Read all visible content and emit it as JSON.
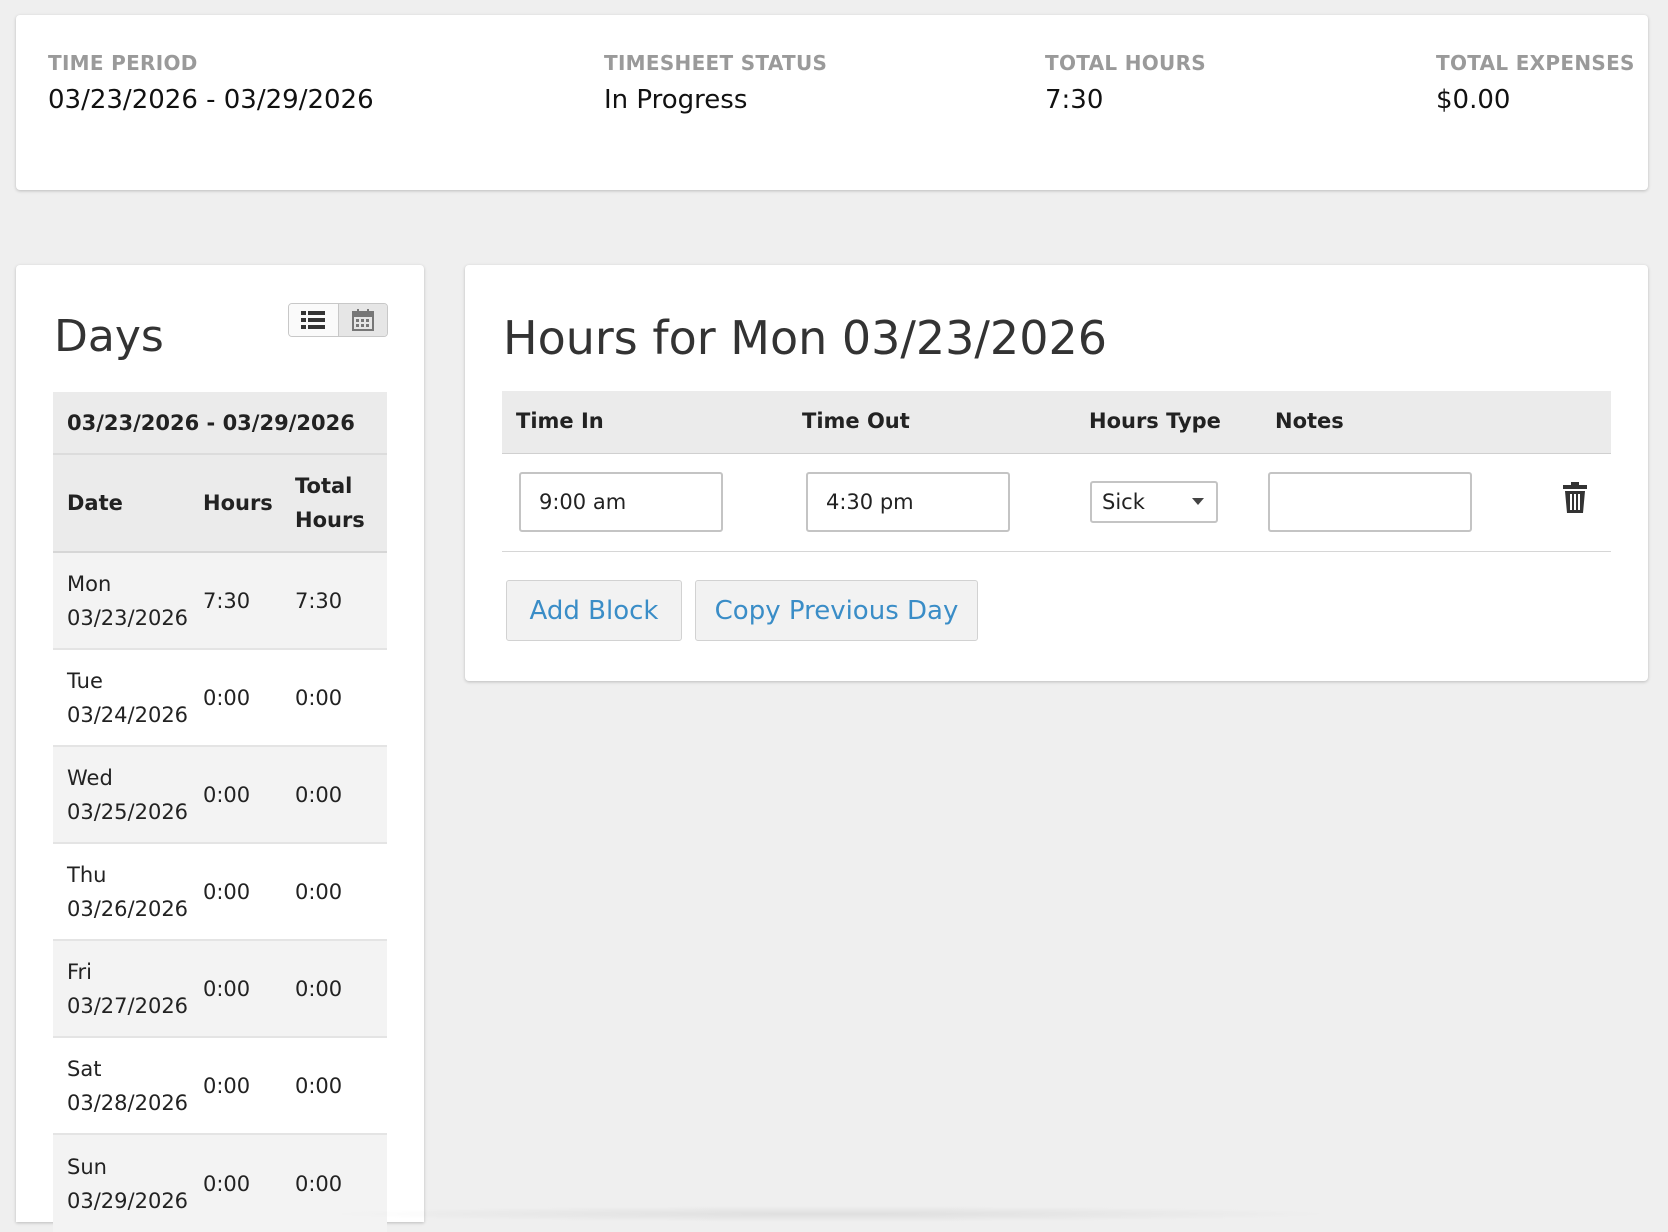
{
  "summary": {
    "time_period": {
      "label": "TIME PERIOD",
      "value": "03/23/2026 - 03/29/2026"
    },
    "status": {
      "label": "TIMESHEET STATUS",
      "value": "In Progress"
    },
    "total_hours": {
      "label": "TOTAL HOURS",
      "value": "7:30"
    },
    "total_expenses": {
      "label": "TOTAL EXPENSES",
      "value": "$0.00"
    }
  },
  "days": {
    "title": "Days",
    "range": "03/23/2026 - 03/29/2026",
    "headers": {
      "date": "Date",
      "hours": "Hours",
      "total_line1": "Total",
      "total_line2": "Hours"
    },
    "rows": [
      {
        "day": "Mon",
        "date": "03/23/2026",
        "hours": "7:30",
        "total": "7:30"
      },
      {
        "day": "Tue",
        "date": "03/24/2026",
        "hours": "0:00",
        "total": "0:00"
      },
      {
        "day": "Wed",
        "date": "03/25/2026",
        "hours": "0:00",
        "total": "0:00"
      },
      {
        "day": "Thu",
        "date": "03/26/2026",
        "hours": "0:00",
        "total": "0:00"
      },
      {
        "day": "Fri",
        "date": "03/27/2026",
        "hours": "0:00",
        "total": "0:00"
      },
      {
        "day": "Sat",
        "date": "03/28/2026",
        "hours": "0:00",
        "total": "0:00"
      },
      {
        "day": "Sun",
        "date": "03/29/2026",
        "hours": "0:00",
        "total": "0:00"
      }
    ],
    "view_icons": {
      "list": "list-icon",
      "calendar": "calendar-icon"
    }
  },
  "hours": {
    "title": "Hours for Mon 03/23/2026",
    "headers": {
      "time_in": "Time In",
      "time_out": "Time Out",
      "hours_type": "Hours Type",
      "notes": "Notes"
    },
    "block": {
      "time_in": "9:00 am",
      "time_out": "4:30 pm",
      "hours_type": "Sick",
      "notes": ""
    },
    "add_block_label": "Add Block",
    "copy_previous_label": "Copy Previous Day",
    "delete_icon": "trash-icon"
  },
  "colors": {
    "accent": "#3a8dc7",
    "background": "#efefef",
    "header_bg": "#ebebeb"
  }
}
